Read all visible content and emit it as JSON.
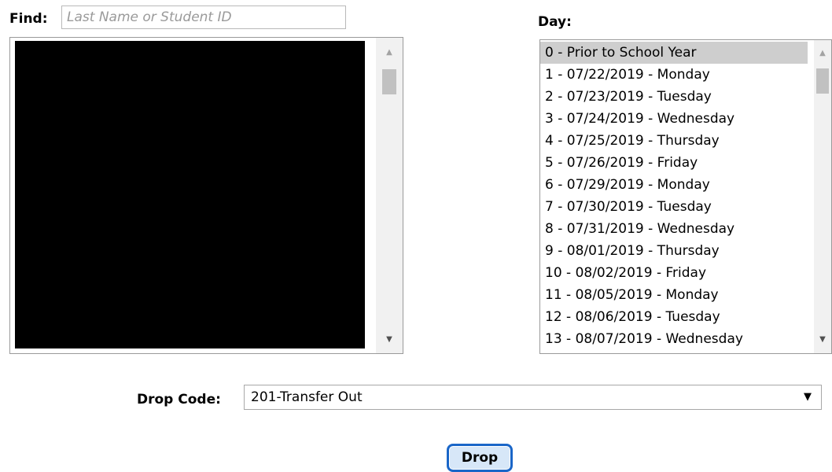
{
  "find": {
    "label": "Find:",
    "placeholder": "Last Name or Student ID",
    "value": ""
  },
  "day": {
    "label": "Day:",
    "selected_index": 0,
    "items": [
      "0 - Prior to School Year",
      "1 - 07/22/2019 - Monday",
      "2 - 07/23/2019 - Tuesday",
      "3 - 07/24/2019 - Wednesday",
      "4 - 07/25/2019 - Thursday",
      "5 - 07/26/2019 - Friday",
      "6 - 07/29/2019 - Monday",
      "7 - 07/30/2019 - Tuesday",
      "8 - 07/31/2019 - Wednesday",
      "9 - 08/01/2019 - Thursday",
      "10 - 08/02/2019 - Friday",
      "11 - 08/05/2019 - Monday",
      "12 - 08/06/2019 - Tuesday",
      "13 - 08/07/2019 - Wednesday"
    ]
  },
  "drop_code": {
    "label": "Drop Code:",
    "selected": "201-Transfer Out"
  },
  "drop_button": {
    "label": "Drop"
  },
  "icons": {
    "scroll_up": "arrow-up-icon",
    "scroll_down": "arrow-down-icon",
    "dropdown": "chevron-down-icon"
  },
  "colors": {
    "selected_row": "#cecece",
    "button_border": "#1a66c8",
    "button_fill": "#d7e7f8"
  }
}
